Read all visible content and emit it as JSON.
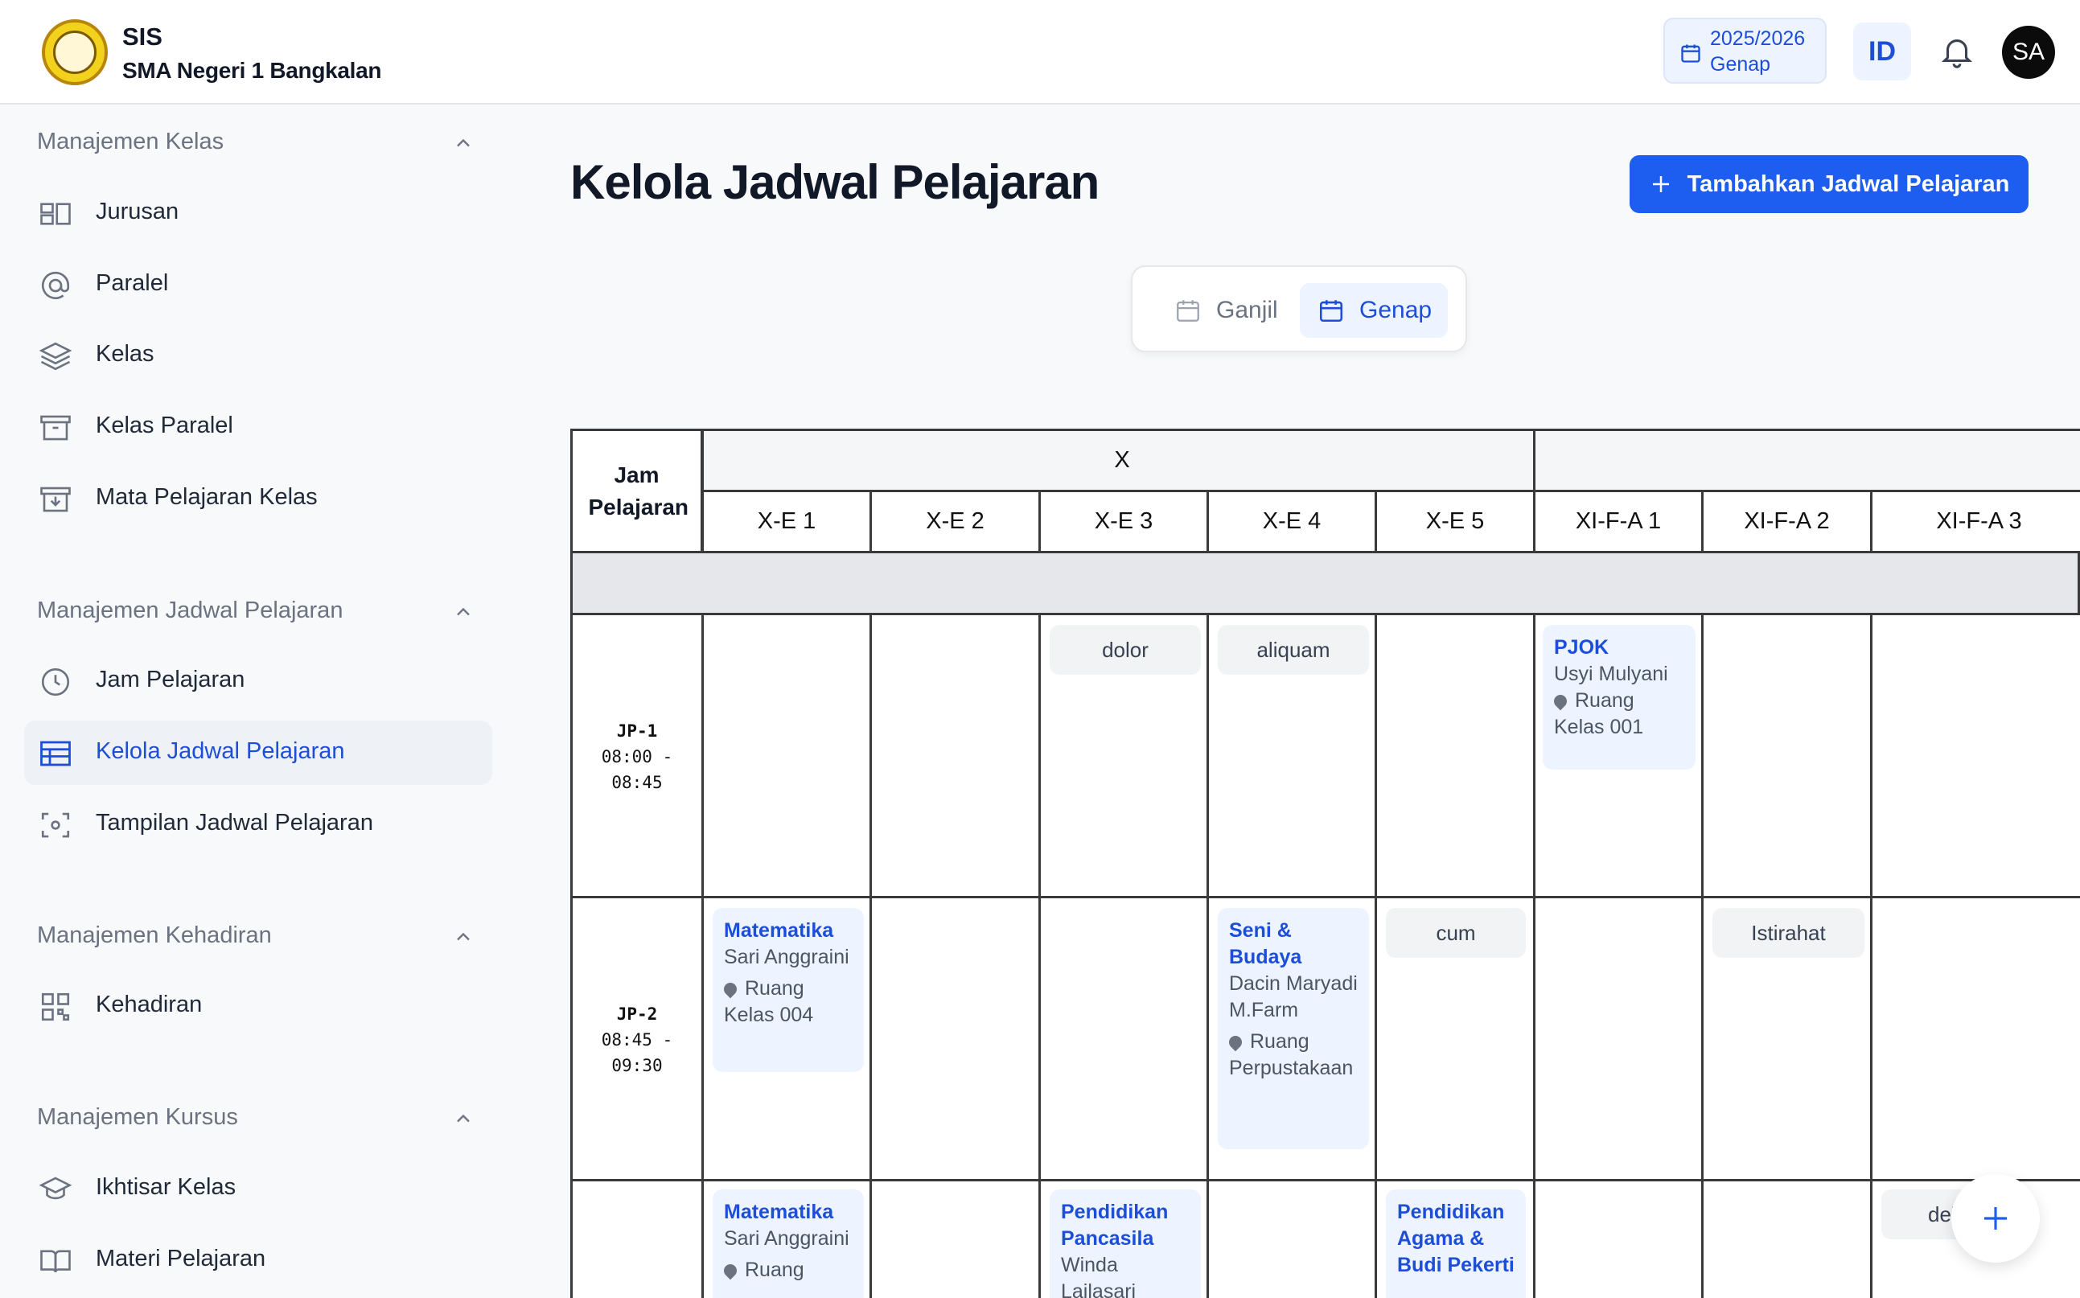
{
  "header": {
    "app_name": "SIS",
    "school_name": "SMA Negeri 1 Bangkalan",
    "academic_year": "2025/2026",
    "semester": "Genap",
    "language": "ID",
    "avatar_initials": "SA"
  },
  "sidebar": {
    "sections": [
      {
        "title": "Manajemen Kelas",
        "items": [
          "Jurusan",
          "Paralel",
          "Kelas",
          "Kelas Paralel",
          "Mata Pelajaran Kelas"
        ]
      },
      {
        "title": "Manajemen Jadwal Pelajaran",
        "items": [
          "Jam Pelajaran",
          "Kelola Jadwal Pelajaran",
          "Tampilan Jadwal Pelajaran"
        ]
      },
      {
        "title": "Manajemen Kehadiran",
        "items": [
          "Kehadiran"
        ]
      },
      {
        "title": "Manajemen Kursus",
        "items": [
          "Ikhtisar Kelas",
          "Materi Pelajaran"
        ]
      }
    ],
    "active_item": "Kelola Jadwal Pelajaran"
  },
  "main": {
    "title": "Kelola Jadwal Pelajaran",
    "add_button": "Tambahkan Jadwal Pelajaran",
    "semester_tabs": [
      "Ganjil",
      "Genap"
    ],
    "active_semester": "Genap"
  },
  "schedule": {
    "jp_header": "Jam Pelajaran",
    "grade_groups": [
      "X",
      ""
    ],
    "classes": [
      "X-E 1",
      "X-E 2",
      "X-E 3",
      "X-E 4",
      "X-E 5",
      "XI-F-A 1",
      "XI-F-A 2",
      "XI-F-A 3"
    ],
    "periods": [
      {
        "code": "JP-1",
        "start": "08:00 -",
        "end": "08:45"
      },
      {
        "code": "JP-2",
        "start": "08:45 -",
        "end": "09:30"
      }
    ],
    "chips": {
      "r1_xe3": "dolor",
      "r1_xe4": "aliquam",
      "r2_xe5": "cum",
      "r2_xifa2": "Istirahat",
      "r3_xifa3": "del"
    },
    "cards": {
      "r1_xifa1": {
        "subject": "PJOK",
        "teacher": "Usyi Mulyani",
        "room": "Ruang Kelas 001"
      },
      "r2_xe1": {
        "subject": "Matematika",
        "teacher": "Sari Anggraini",
        "room": "Ruang Kelas 004"
      },
      "r2_xe4": {
        "subject": "Seni & Budaya",
        "teacher": "Dacin Maryadi M.Farm",
        "room": "Ruang Perpustakaan"
      },
      "r3_xe1": {
        "subject": "Matematika",
        "teacher": "Sari Anggraini",
        "room": "Ruang"
      },
      "r3_xe3": {
        "subject": "Pendidikan Pancasila",
        "teacher": "Winda Lailasari",
        "room": ""
      },
      "r3_xe5": {
        "subject": "Pendidikan Agama & Budi Pekerti",
        "teacher": "",
        "room": ""
      }
    }
  },
  "colors": {
    "accent": "#1d5ef1",
    "active_text": "#1d4ed8",
    "card_bg": "#eef4ff"
  }
}
